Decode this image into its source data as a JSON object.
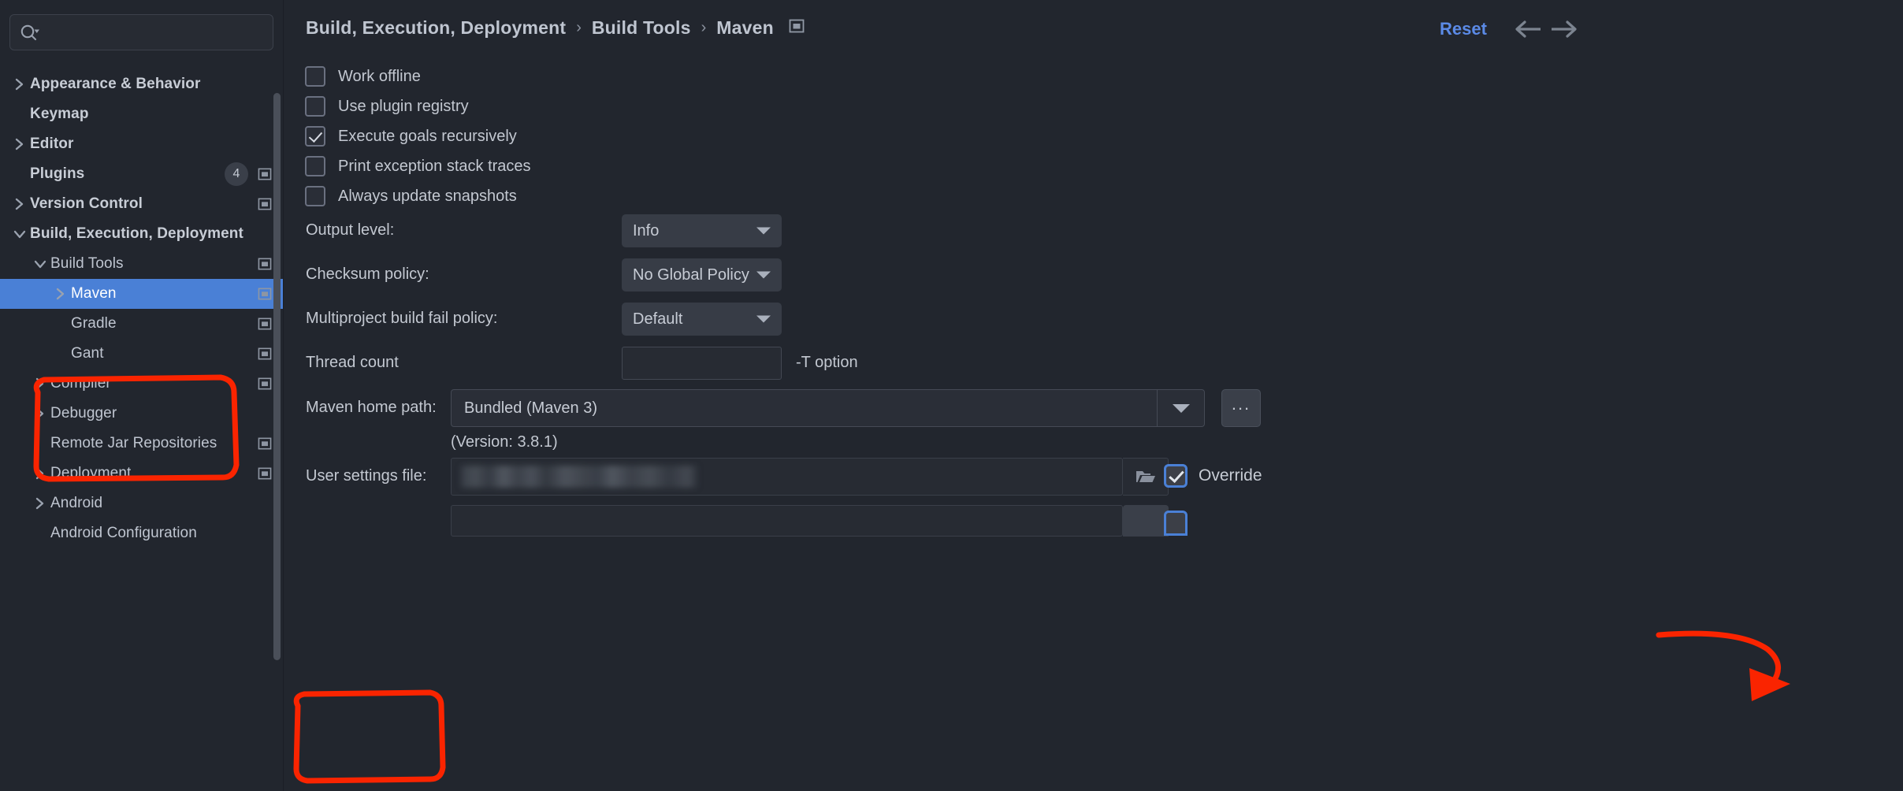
{
  "accent": {
    "selection_blue": "#4A80D6",
    "link_blue": "#5B8AE6",
    "annotation_red": "#FF2200"
  },
  "search": {
    "placeholder": "",
    "value": "",
    "icon": "search-icon"
  },
  "sidebar": {
    "items": [
      {
        "label": "Appearance & Behavior",
        "indent": 0,
        "arrow": "chevron-right",
        "bold": true,
        "badge": "",
        "win_icon": false,
        "selected": false
      },
      {
        "label": "Keymap",
        "indent": 0,
        "arrow": "none",
        "bold": true,
        "badge": "",
        "win_icon": false,
        "selected": false
      },
      {
        "label": "Editor",
        "indent": 0,
        "arrow": "chevron-right",
        "bold": true,
        "badge": "",
        "win_icon": false,
        "selected": false
      },
      {
        "label": "Plugins",
        "indent": 0,
        "arrow": "none",
        "bold": true,
        "badge": "4",
        "win_icon": true,
        "selected": false
      },
      {
        "label": "Version Control",
        "indent": 0,
        "arrow": "chevron-right",
        "bold": true,
        "badge": "",
        "win_icon": true,
        "selected": false
      },
      {
        "label": "Build, Execution, Deployment",
        "indent": 0,
        "arrow": "chevron-down",
        "bold": true,
        "badge": "",
        "win_icon": false,
        "selected": false
      },
      {
        "label": "Build Tools",
        "indent": 1,
        "arrow": "chevron-down",
        "bold": false,
        "badge": "",
        "win_icon": true,
        "selected": false
      },
      {
        "label": "Maven",
        "indent": 2,
        "arrow": "chevron-right",
        "bold": false,
        "badge": "",
        "win_icon": true,
        "selected": true
      },
      {
        "label": "Gradle",
        "indent": 2,
        "arrow": "none",
        "bold": false,
        "badge": "",
        "win_icon": true,
        "selected": false
      },
      {
        "label": "Gant",
        "indent": 2,
        "arrow": "none",
        "bold": false,
        "badge": "",
        "win_icon": true,
        "selected": false
      },
      {
        "label": "Compiler",
        "indent": 1,
        "arrow": "chevron-right",
        "bold": false,
        "badge": "",
        "win_icon": true,
        "selected": false
      },
      {
        "label": "Debugger",
        "indent": 1,
        "arrow": "chevron-right",
        "bold": false,
        "badge": "",
        "win_icon": false,
        "selected": false
      },
      {
        "label": "Remote Jar Repositories",
        "indent": 1,
        "arrow": "none",
        "bold": false,
        "badge": "",
        "win_icon": true,
        "selected": false
      },
      {
        "label": "Deployment",
        "indent": 1,
        "arrow": "chevron-right",
        "bold": false,
        "badge": "",
        "win_icon": true,
        "selected": false
      },
      {
        "label": "Android",
        "indent": 1,
        "arrow": "chevron-right",
        "bold": false,
        "badge": "",
        "win_icon": false,
        "selected": false
      },
      {
        "label": "Android Configuration",
        "indent": 1,
        "arrow": "none",
        "bold": false,
        "badge": "",
        "win_icon": false,
        "selected": false
      }
    ]
  },
  "header": {
    "breadcrumb": [
      "Build, Execution, Deployment",
      "Build Tools",
      "Maven"
    ],
    "separator": "›",
    "reset_label": "Reset",
    "back_icon": "arrow-left-icon",
    "forward_icon": "arrow-right-icon",
    "window_icon": "open-in-window-icon"
  },
  "form": {
    "checkboxes": [
      {
        "label": "Work offline",
        "checked": false
      },
      {
        "label": "Use plugin registry",
        "checked": false
      },
      {
        "label": "Execute goals recursively",
        "checked": true
      },
      {
        "label": "Print exception stack traces",
        "checked": false
      },
      {
        "label": "Always update snapshots",
        "checked": false
      }
    ],
    "output_level": {
      "label": "Output level:",
      "value": "Info"
    },
    "checksum_policy": {
      "label": "Checksum policy:",
      "value": "No Global Policy"
    },
    "fail_policy": {
      "label": "Multiproject build fail policy:",
      "value": "Default"
    },
    "thread_count": {
      "label": "Thread count",
      "value": "",
      "hint": "-T option"
    },
    "maven_home": {
      "label": "Maven home path:",
      "value": "Bundled (Maven 3)",
      "version_note": "(Version: 3.8.1)",
      "browse_label": "..."
    },
    "user_settings": {
      "label": "User settings file:",
      "value": "",
      "folder_icon": "folder-icon",
      "override_label": "Override",
      "override_checked": true
    }
  },
  "annotations": {
    "sidebar_box": "red-rounded-rect-around-maven",
    "label_box": "red-rounded-rect-around-user-settings-file",
    "arrow": "red-curved-arrow-to-override-checkbox"
  }
}
